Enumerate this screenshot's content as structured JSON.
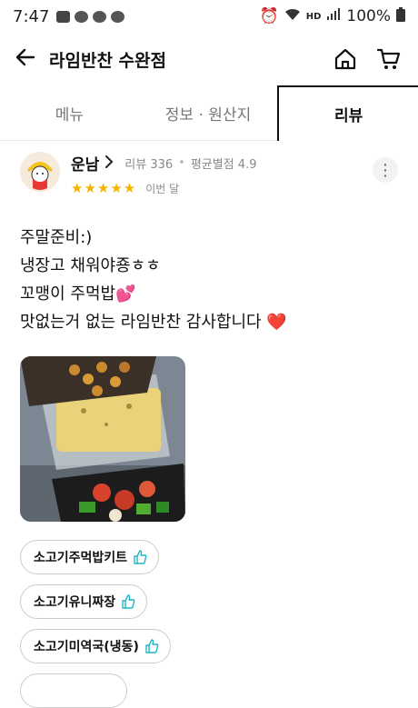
{
  "status_bar": {
    "time": "7:47",
    "battery": "100%",
    "network": "HD"
  },
  "app_bar": {
    "title": "라임반찬 수완점",
    "icons": [
      "back-arrow-icon",
      "home-icon",
      "cart-icon"
    ]
  },
  "tabs": [
    {
      "label": "메뉴",
      "active": false
    },
    {
      "label": "정보 · 원산지",
      "active": false
    },
    {
      "label": "리뷰",
      "active": true
    }
  ],
  "review": {
    "user_name": "운남",
    "review_count_label": "리뷰 336",
    "avg_rating_label": "평균별점 4.9",
    "stars": 5,
    "star_glyphs": "★★★★★",
    "when": "이번 달",
    "lines": [
      "주말준비:)",
      "냉장고 채워야죵ㅎㅎ",
      "꼬맹이 주먹밥💕",
      "맛없는거 없는 라임반찬 감사합니다 ❤️"
    ],
    "menu_tags": [
      "소고기주먹밥키트",
      "소고기유니짜장",
      "소고기미역국(냉동)"
    ]
  },
  "colors": {
    "star": "#f5b400",
    "thumb": "#1fb5c2",
    "accent": "#111111"
  }
}
